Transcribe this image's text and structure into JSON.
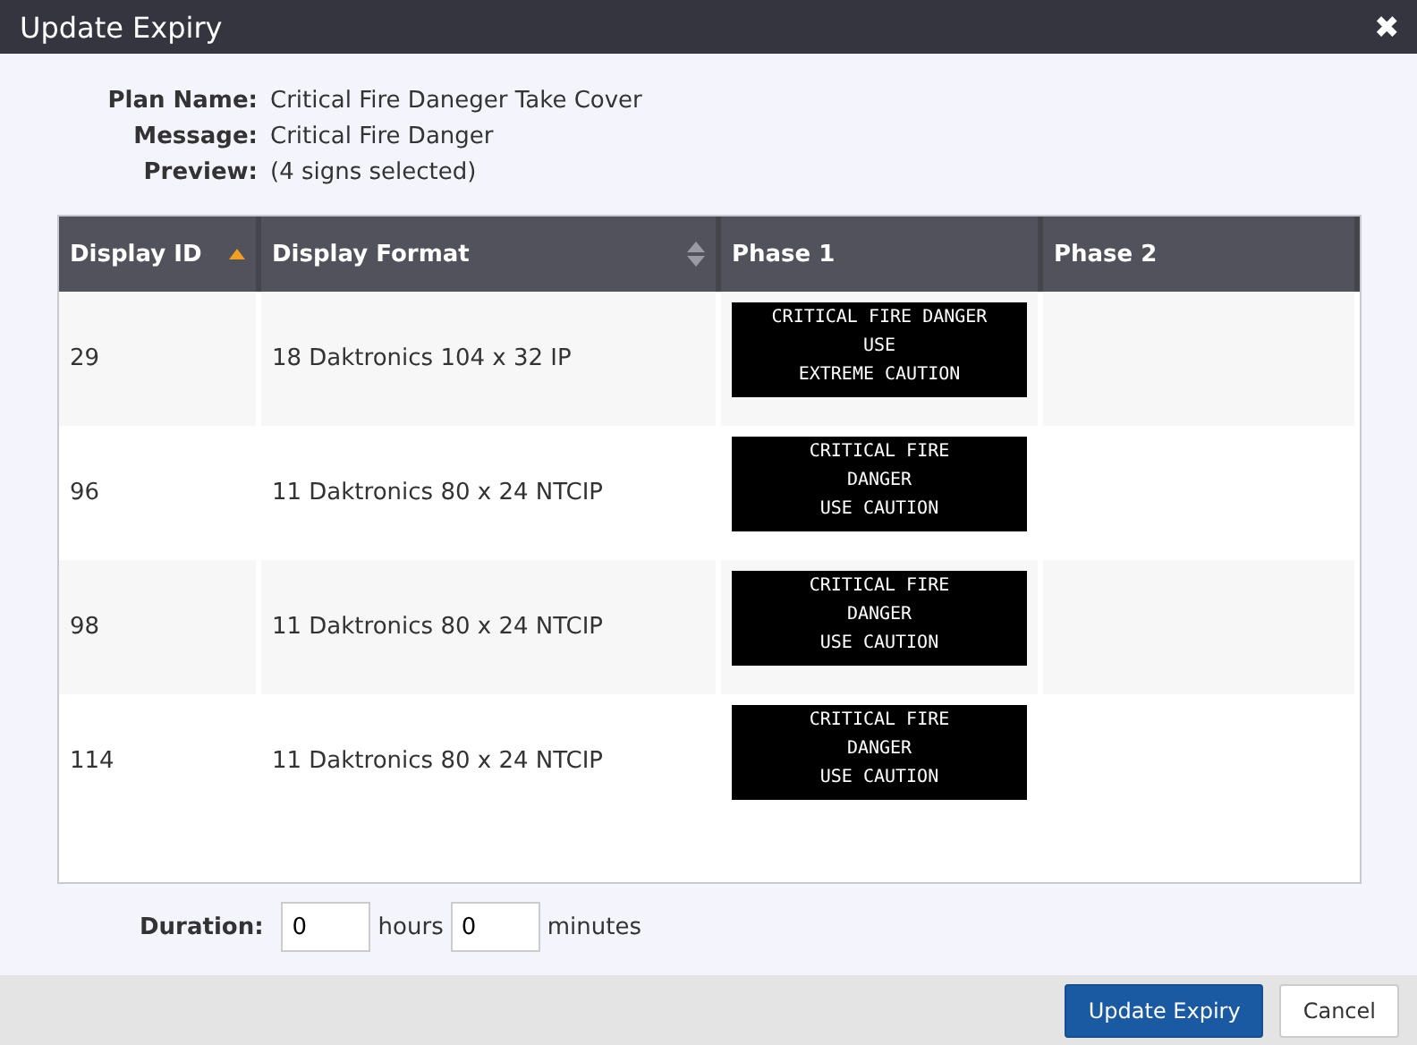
{
  "window": {
    "title": "Update Expiry",
    "close": "✖"
  },
  "info": [
    {
      "label": "Plan Name:",
      "value": "Critical Fire Daneger Take Cover"
    },
    {
      "label": "Message:",
      "value": "Critical Fire Danger"
    },
    {
      "label": "Preview:",
      "value": "(4 signs selected)"
    }
  ],
  "table": {
    "columns": [
      {
        "label": "Display ID",
        "sorted_ascending": true
      },
      {
        "label": "Display Format",
        "sorted_ascending": false,
        "sortable": true
      },
      {
        "label": "Phase 1",
        "sorted_ascending": false,
        "sortable": false
      },
      {
        "label": "Phase 2",
        "sorted_ascending": false,
        "sortable": false
      }
    ],
    "rows": [
      {
        "id": "29",
        "format": "18 Daktronics 104 x 32 IP",
        "phase_1": [
          "CRITICAL FIRE DANGER",
          "USE",
          "EXTREME CAUTION"
        ]
      },
      {
        "id": "96",
        "format": "11 Daktronics 80 x 24 NTCIP",
        "phase_1": [
          "CRITICAL FIRE",
          "DANGER",
          "USE CAUTION"
        ]
      },
      {
        "id": "98",
        "format": "11 Daktronics 80 x 24 NTCIP",
        "phase_1": [
          "CRITICAL FIRE",
          "DANGER",
          "USE CAUTION"
        ]
      },
      {
        "id": "114",
        "format": "11 Daktronics 80 x 24 NTCIP",
        "phase_1": [
          "CRITICAL FIRE",
          "DANGER",
          "USE CAUTION"
        ]
      }
    ]
  },
  "duration": {
    "label": "Duration:",
    "hours": "0",
    "hours_unit": "hours",
    "minutes": "0",
    "minutes_unit": "minutes"
  },
  "buttons": [
    {
      "label": "Update Expiry",
      "kind": "primary"
    },
    {
      "label": "Cancel",
      "kind": "default"
    }
  ]
}
